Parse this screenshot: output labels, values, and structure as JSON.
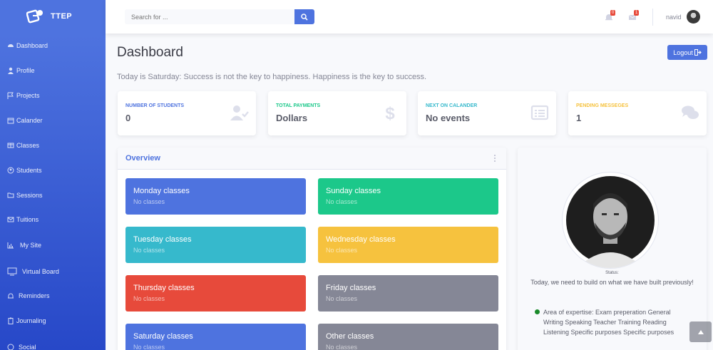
{
  "brand": {
    "name": "TTEP"
  },
  "sidebar": {
    "items": [
      {
        "label": "Dashboard",
        "icon": "dashboard-icon"
      },
      {
        "label": "Profile",
        "icon": "user-icon"
      },
      {
        "label": "Projects",
        "icon": "flag-icon"
      },
      {
        "label": "Calander",
        "icon": "calendar-icon"
      },
      {
        "label": "Classes",
        "icon": "table-icon"
      },
      {
        "label": "Students",
        "icon": "user-circle-icon"
      },
      {
        "label": "Sessions",
        "icon": "folder-icon"
      },
      {
        "label": "Tuitions",
        "icon": "envelope-icon"
      },
      {
        "label": "My Site",
        "icon": "chart-bar-icon"
      },
      {
        "label": "Virtual Board",
        "icon": "monitor-icon"
      },
      {
        "label": "Reminders",
        "icon": "bell-icon"
      },
      {
        "label": "Journaling",
        "icon": "clipboard-icon"
      },
      {
        "label": "Social",
        "icon": "globe-icon"
      }
    ]
  },
  "topbar": {
    "search_placeholder": "Search for ...",
    "alerts_count": "0",
    "messages_count": "1",
    "user_name": "navid"
  },
  "header": {
    "title": "Dashboard",
    "logout_label": "Logout",
    "quote": "Today is Saturday: Success is not the key to happiness. Happiness is the key to success."
  },
  "stats": [
    {
      "label": "Number of Students",
      "value": "0",
      "color": "#4e73df",
      "icon": "user-check-icon"
    },
    {
      "label": "Total Payments",
      "value": "Dollars",
      "color": "#1cc88a",
      "icon": "dollar-icon"
    },
    {
      "label": "Next on Calander",
      "value": "No events",
      "color": "#36b9cc",
      "icon": "list-alt-icon"
    },
    {
      "label": "Pending Messeges",
      "value": "1",
      "color": "#f6c23e",
      "icon": "comments-icon"
    }
  ],
  "overview": {
    "title": "Overview",
    "classes": [
      {
        "title": "Monday classes",
        "sub": "No classes",
        "color": "#4e73df"
      },
      {
        "title": "Sunday classes",
        "sub": "No classes",
        "color": "#1cc88a"
      },
      {
        "title": "Tuesday classes",
        "sub": "No classes",
        "color": "#36b9cc"
      },
      {
        "title": "Wednesday classes",
        "sub": "No classes",
        "color": "#f6c23e"
      },
      {
        "title": "Thursday classes",
        "sub": "No classes",
        "color": "#e74a3b"
      },
      {
        "title": "Friday classes",
        "sub": "No classes",
        "color": "#858796"
      },
      {
        "title": "Saturday classes",
        "sub": "No classes",
        "color": "#4e73df"
      },
      {
        "title": "Other classes",
        "sub": "No classes",
        "color": "#858796"
      }
    ]
  },
  "profile": {
    "status_label": "Status:",
    "message": "Today, we need to build on what we have built previously!",
    "expertise": "Area of expertise: Exam preperation General Writing Speaking Teacher Training Reading Listening Specific purposes Specific purposes"
  }
}
